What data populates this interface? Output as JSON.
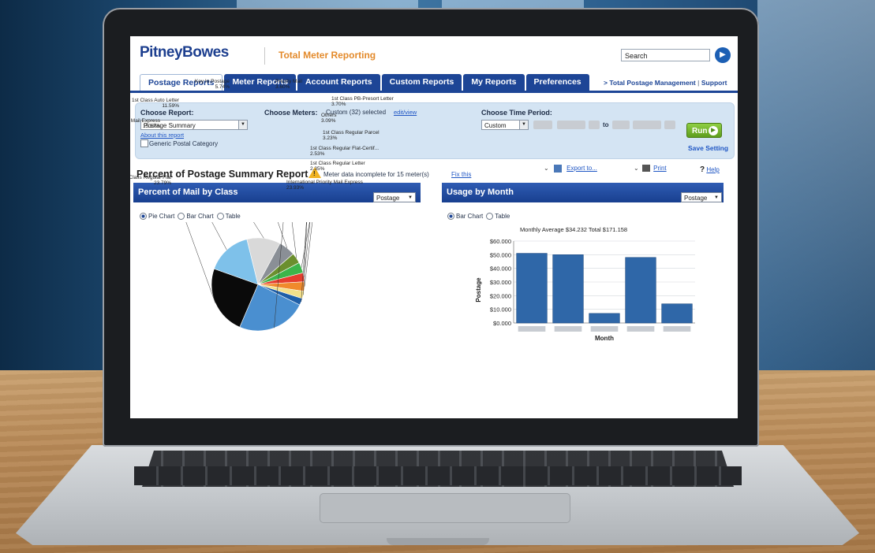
{
  "app": {
    "brand": "PitneyBowes",
    "title": "Total Meter Reporting",
    "search_placeholder": "Search",
    "search_go_icon": "arrow-right-icon"
  },
  "tabs": [
    {
      "label": "Postage Reports",
      "active": true
    },
    {
      "label": "Meter Reports",
      "active": false
    },
    {
      "label": "Account Reports",
      "active": false
    },
    {
      "label": "Custom Reports",
      "active": false
    },
    {
      "label": "My Reports",
      "active": false
    },
    {
      "label": "Preferences",
      "active": false
    }
  ],
  "tab_links": {
    "total_postage": "> Total Postage Management",
    "separator": "|",
    "support": "Support"
  },
  "filters": {
    "choose_report_label": "Choose Report:",
    "report_value": "Postage Summary",
    "about_link": "About this report",
    "generic_label": "Generic Postal Category",
    "choose_meters_label": "Choose Meters:",
    "meters_value": "Custom (32) selected",
    "meters_link": "edit/view",
    "choose_time_label": "Choose Time Period:",
    "time_value": "Custom",
    "to_label": "to",
    "run_label": "Run",
    "save_label": "Save Setting"
  },
  "report": {
    "title": "Percent of Postage Summary Report",
    "warning_text": "Meter data incomplete for 15 meter(s)",
    "fix_link": "Fix this",
    "export_link": "Export to...",
    "print_link": "Print",
    "help_prefix": "?",
    "help_link": "Help"
  },
  "left_panel": {
    "title": "Percent of Mail by Class",
    "select_value": "Postage",
    "radios": [
      "Pie Chart",
      "Bar Chart",
      "Table"
    ],
    "selected_radio": "Pie Chart"
  },
  "right_panel": {
    "title": "Usage by Month",
    "select_value": "Postage",
    "radios": [
      "Bar Chart",
      "Table"
    ],
    "selected_radio": "Bar Chart",
    "summary": "Monthly Average  $34.232   Total  $171.158"
  },
  "colors": {
    "brand_blue": "#1d4596",
    "accent_orange": "#e38a2b",
    "run_green": "#6fb02a",
    "bar_blue": "#2f67a8"
  },
  "chart_data": [
    {
      "type": "pie",
      "title": "Percent of Mail by Class",
      "slices": [
        {
          "label": "1st Class Regular Letter",
          "pct": "2.35%",
          "value": 2.35,
          "color": "#1f5fa8"
        },
        {
          "label": "International Priority Mail Express",
          "pct": "23.93%",
          "value": 23.93,
          "color": "#4a8fd0"
        },
        {
          "label": "1st Class Regular Flat",
          "pct": "23.79%",
          "value": 23.79,
          "color": "#0a0a0a"
        },
        {
          "label": "Priority Mail Express",
          "pct": "15.57%",
          "value": 15.57,
          "color": "#7ec1ea"
        },
        {
          "label": "1st Class Auto Letter",
          "pct": "11.59%",
          "value": 11.59,
          "color": "#d9d9d9"
        },
        {
          "label": "Key In Postage",
          "pct": "5.74%",
          "value": 5.74,
          "color": "#8a8f96"
        },
        {
          "label": "Priority Mail",
          "pct": "3.60%",
          "value": 3.6,
          "color": "#6b8f2e"
        },
        {
          "label": "1st Class PB-Presort Letter",
          "pct": "3.70%",
          "value": 3.7,
          "color": "#3cb54a"
        },
        {
          "label": "Others",
          "pct": "3.09%",
          "value": 3.09,
          "color": "#e53d2e"
        },
        {
          "label": "1st Class Regular Parcel",
          "pct": "3.23%",
          "value": 3.23,
          "color": "#f08a2c"
        },
        {
          "label": "1st Class Regular Flat-Certif...",
          "pct": "2.53%",
          "value": 2.53,
          "color": "#f2e08a"
        }
      ]
    },
    {
      "type": "bar",
      "title": "Usage by Month",
      "xlabel": "Month",
      "ylabel": "Postage",
      "ylim": [
        0,
        60000
      ],
      "yticks": [
        "$0.000",
        "$10.000",
        "$20.000",
        "$30.000",
        "$40.000",
        "$50.000",
        "$60.000"
      ],
      "categories": [
        "",
        "",
        "",
        "",
        ""
      ],
      "values": [
        51000,
        50000,
        7000,
        48000,
        14000
      ],
      "grid": true
    }
  ]
}
